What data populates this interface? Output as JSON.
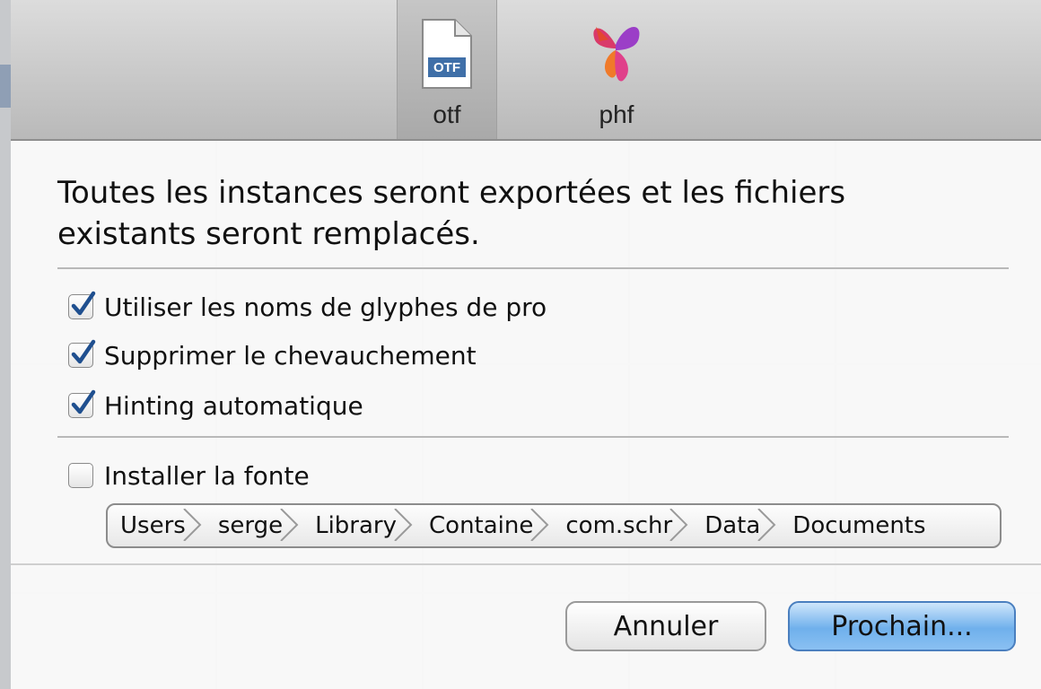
{
  "toolbar": {
    "items": [
      {
        "label": "otf",
        "icon": "otf-file-icon",
        "selected": true,
        "badge": "OTF"
      },
      {
        "label": "phf",
        "icon": "butterfly-logo-icon",
        "selected": false
      }
    ]
  },
  "message": "Toutes les instances seront exportées et les fichiers existants seront remplacés.",
  "options": [
    {
      "label": "Utiliser les noms de glyphes de pro",
      "checked": true
    },
    {
      "label": "Supprimer le chevauchement",
      "checked": true
    },
    {
      "label": "Hinting automatique",
      "checked": true
    }
  ],
  "install": {
    "label": "Installer la fonte",
    "checked": false
  },
  "path": [
    "Users",
    "serge",
    "Library",
    "Containe",
    "com.schr",
    "Data",
    "Documents"
  ],
  "buttons": {
    "cancel": "Annuler",
    "next": "Prochain..."
  },
  "colors": {
    "accent": "#6fb0ec",
    "check": "#1f4f8f"
  }
}
